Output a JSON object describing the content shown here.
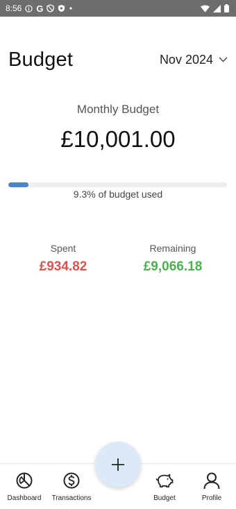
{
  "status_bar": {
    "time": "8:56",
    "g_label": "G"
  },
  "header": {
    "title": "Budget",
    "month": "Nov 2024"
  },
  "summary": {
    "monthly_label": "Monthly Budget",
    "monthly_amount": "£10,001.00",
    "progress_fraction": 0.093,
    "progress_text": "9.3% of budget used",
    "spent_label": "Spent",
    "spent_value": "£934.82",
    "remaining_label": "Remaining",
    "remaining_value": "£9,066.18"
  },
  "colors": {
    "accent": "#4a86c8",
    "spent": "#d9534f",
    "remaining": "#4caf50",
    "fab": "#dceaf8"
  },
  "nav": {
    "dashboard": "Dashboard",
    "transactions": "Transactions",
    "budget": "Budget",
    "profile": "Profile"
  },
  "icons": [
    "info-icon",
    "g-icon",
    "shield-icon",
    "wifi-icon",
    "signal-icon",
    "battery-icon",
    "chevron-down-icon",
    "dashboard-icon",
    "dollar-icon",
    "piggy-bank-icon",
    "profile-icon",
    "plus-icon"
  ]
}
